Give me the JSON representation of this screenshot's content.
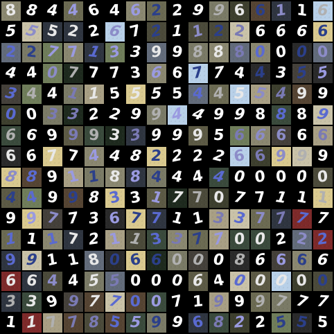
{
  "grid": {
    "rows": [
      [
        "8",
        "8",
        "4",
        "4",
        "6",
        "4",
        "6",
        "2",
        "2",
        "9",
        "9",
        "6",
        "6",
        "1",
        "1",
        "6",
        "6"
      ],
      [
        "5",
        "5",
        "5",
        "2",
        "2",
        "6",
        "7",
        "2",
        "1",
        "1",
        "2",
        "2",
        "6",
        "6"
      ],
      [
        "2",
        "2",
        "7",
        "7",
        "1",
        "3",
        "3",
        "9",
        "9",
        "8",
        "8",
        "8",
        "0",
        "0"
      ],
      [
        "4",
        "4",
        "0",
        "7",
        "7",
        "7",
        "3",
        "6",
        "6",
        "7",
        "7",
        "4",
        "4",
        "3",
        "5"
      ],
      [
        "3",
        "4",
        "4",
        "1",
        "1",
        "5",
        "5",
        "5",
        "5",
        "4",
        "4",
        "5",
        "5",
        "4",
        "9"
      ],
      [
        "0",
        "0",
        "3",
        "3",
        "2",
        "2",
        "9",
        "9",
        "4",
        "4",
        "9",
        "9",
        "8",
        "8",
        "8",
        "9"
      ],
      [
        "6",
        "6",
        "9",
        "9",
        "9",
        "3",
        "3",
        "9",
        "9",
        "9",
        "5",
        "6",
        "6",
        "6"
      ],
      [
        "6",
        "6",
        "7",
        "7",
        "4",
        "4",
        "8",
        "2",
        "2",
        "2",
        "2",
        "6",
        "6",
        "9",
        "9"
      ],
      [
        "8",
        "8",
        "9",
        "1",
        "1",
        "8",
        "8",
        "4",
        "4",
        "4",
        "4",
        "0",
        "0",
        "0"
      ],
      [
        "4",
        "4",
        "9",
        "9",
        "8",
        "3",
        "3",
        "1",
        "7",
        "7",
        "0",
        "7",
        "7",
        "1",
        "1"
      ],
      [
        "9",
        "9",
        "7",
        "7",
        "3",
        "6",
        "7",
        "7",
        "1",
        "1",
        "3",
        "3",
        "7",
        "7"
      ],
      [
        "1",
        "1",
        "1",
        "7",
        "2",
        "1",
        "1",
        "3",
        "3",
        "7",
        "7",
        "0",
        "0",
        "2"
      ],
      [
        "9",
        "9",
        "1",
        "1",
        "8",
        "0",
        "6",
        "6",
        "0",
        "0",
        "0",
        "8",
        "6",
        "6"
      ],
      [
        "6",
        "6",
        "4",
        "4",
        "5",
        "5",
        "0",
        "0",
        "0",
        "6",
        "4",
        "0",
        "0",
        "0"
      ],
      [
        "3",
        "3",
        "9",
        "9",
        "7",
        "7",
        "0",
        "0",
        "7",
        "1",
        "9",
        "9",
        "9",
        "7",
        "7",
        "7"
      ],
      [
        "1",
        "1",
        "7",
        "7",
        "8",
        "5",
        "5",
        "9",
        "9",
        "6",
        "8",
        "2",
        "2",
        "5",
        "5",
        "5"
      ]
    ]
  },
  "palette": {
    "backgrounds": [
      "#000000",
      "#2a2a2a",
      "#3d3f2e",
      "#4b4a3a",
      "#5c5a45",
      "#6b6a52",
      "#3a4a3c",
      "#554433",
      "#7a7a66",
      "#2f3540",
      "#626b7a",
      "#8a8770",
      "#1e2a1e",
      "#44403a",
      "#a89f84",
      "#c9c2a8",
      "#7d2a2a",
      "#b8d0e8",
      "#d9c98f",
      "#6f7d5a"
    ],
    "inks": [
      "#ffffff",
      "#e8e8e8",
      "#8c8cc8",
      "#7a7ab4",
      "#2b3f8a",
      "#9a9ae0",
      "#b0b0b0",
      "#5a6ad0"
    ]
  }
}
